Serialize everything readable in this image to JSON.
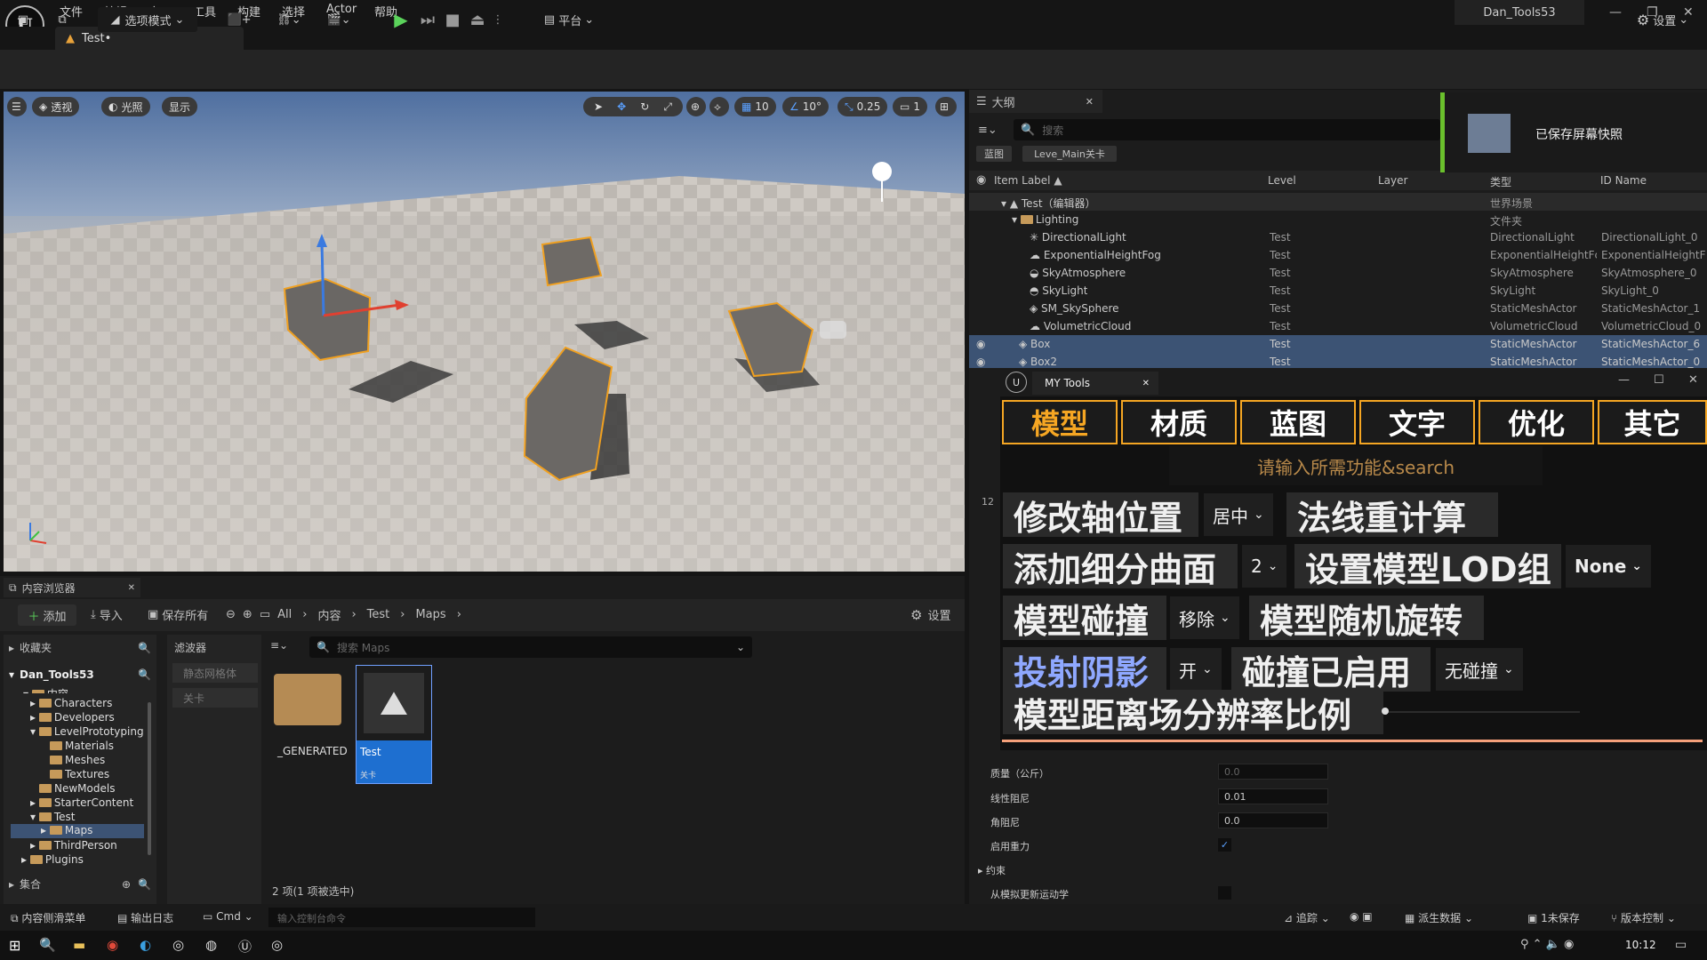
{
  "menubar": {
    "items": [
      "文件",
      "编辑",
      "窗口",
      "工具",
      "构建",
      "选择",
      "Actor",
      "帮助"
    ],
    "project_title": "Dan_Tools53"
  },
  "tab": {
    "title": "Test•"
  },
  "toolbar": {
    "mode_label": "选项模式",
    "platform_label": "平台",
    "settings_label": "设置"
  },
  "viewport": {
    "perspective": "透视",
    "lighting": "光照",
    "show": "显示",
    "grid_snap": "10",
    "angle_snap": "10°",
    "scale_snap": "0.25",
    "camera_speed": "1"
  },
  "outliner": {
    "title": "大纲",
    "search_placeholder": "搜索",
    "chip_blueprint": "蓝图",
    "chip_level": "Leve_Main关卡",
    "columns": [
      "Item Label ▲",
      "Level",
      "Layer",
      "类型",
      "ID Name"
    ],
    "rows": [
      {
        "label": "Test（编辑器）",
        "level": "",
        "type": "世界场景",
        "id": ""
      },
      {
        "label": "Lighting",
        "level": "",
        "type": "文件夹",
        "id": ""
      },
      {
        "label": "DirectionalLight",
        "level": "Test",
        "type": "DirectionalLight",
        "id": "DirectionalLight_0"
      },
      {
        "label": "ExponentialHeightFog",
        "level": "Test",
        "type": "ExponentialHeightFc",
        "id": "ExponentialHeightFc"
      },
      {
        "label": "SkyAtmosphere",
        "level": "Test",
        "type": "SkyAtmosphere",
        "id": "SkyAtmosphere_0"
      },
      {
        "label": "SkyLight",
        "level": "Test",
        "type": "SkyLight",
        "id": "SkyLight_0"
      },
      {
        "label": "SM_SkySphere",
        "level": "Test",
        "type": "StaticMeshActor",
        "id": "StaticMeshActor_1"
      },
      {
        "label": "VolumetricCloud",
        "level": "Test",
        "type": "VolumetricCloud",
        "id": "VolumetricCloud_0"
      },
      {
        "label": "Box",
        "level": "Test",
        "type": "StaticMeshActor",
        "id": "StaticMeshActor_6"
      },
      {
        "label": "Box2",
        "level": "Test",
        "type": "StaticMeshActor",
        "id": "StaticMeshActor_0"
      }
    ]
  },
  "notification": {
    "text": "已保存屏幕快照"
  },
  "mytools": {
    "title": "MY Tools",
    "tabs": [
      "模型",
      "材质",
      "蓝图",
      "文字",
      "优化",
      "其它"
    ],
    "search_placeholder": "请输入所需功能&search",
    "side_number": "12",
    "buttons": {
      "pivot": "修改轴位置",
      "pivot_option": "居中",
      "normal": "法线重计算",
      "subdiv": "添加细分曲面",
      "subdiv_level": "2",
      "lod": "设置模型LOD组",
      "lod_option": "None",
      "collision": "模型碰撞",
      "collision_option": "移除",
      "random_rot": "模型随机旋转",
      "shadow": "投射阴影",
      "shadow_option": "开",
      "collision_enabled": "碰撞已启用",
      "collision_enabled_option": "无碰撞",
      "sdf": "模型距离场分辨率比例"
    }
  },
  "details": {
    "mass_label": "质量（公斤）",
    "mass_value": "0.0",
    "linear_damping_label": "线性阻尼",
    "linear_damping_value": "0.01",
    "angular_damping_label": "角阻尼",
    "angular_damping_value": "0.0",
    "gravity_label": "启用重力",
    "constraints_label": "约束",
    "kinematic_label": "从模拟更新运动学"
  },
  "content_browser": {
    "title": "内容浏览器",
    "add": "添加",
    "import": "导入",
    "save_all": "保存所有",
    "settings": "设置",
    "path": [
      "All",
      "内容",
      "Test",
      "Maps"
    ],
    "favorites": "收藏夹",
    "project": "Dan_Tools53",
    "tree": [
      "内容",
      "Characters",
      "Developers",
      "LevelPrototyping",
      "Materials",
      "Meshes",
      "Textures",
      "NewModels",
      "StarterContent",
      "Test",
      "Maps",
      "ThirdPerson",
      "Plugins"
    ],
    "collections": "集合",
    "filters_label": "滤波器",
    "filter_static_mesh": "静态网格体",
    "filter_level": "关卡",
    "search_placeholder": "搜索 Maps",
    "asset_folder": "_GENERATED",
    "asset_level_name": "Test",
    "asset_level_type": "关卡",
    "status": "2 项(1 项被选中)"
  },
  "statusbar": {
    "drawer": "内容侧滑菜单",
    "output_log": "输出日志",
    "cmd": "Cmd",
    "cmd_placeholder": "输入控制台命令",
    "trace": "追踪",
    "derived_data": "派生数据",
    "unsaved": "1未保存",
    "source_control": "版本控制"
  },
  "taskbar": {
    "time": "10:12"
  }
}
